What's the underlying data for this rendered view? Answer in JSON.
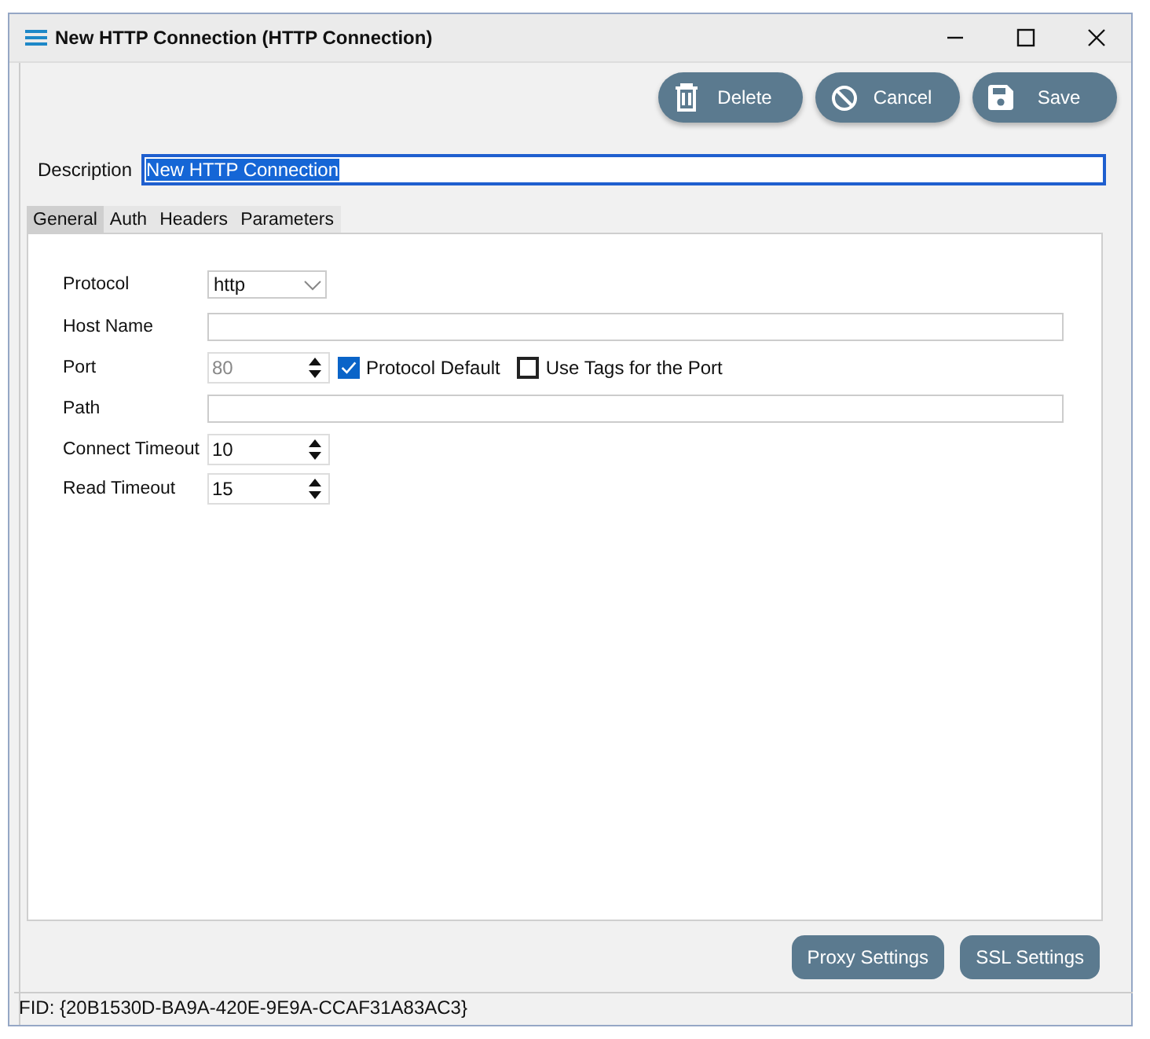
{
  "window": {
    "title": "New HTTP Connection (HTTP Connection)"
  },
  "toolbar": [
    {
      "kind": "delete",
      "label": "Delete"
    },
    {
      "kind": "cancel",
      "label": "Cancel"
    },
    {
      "kind": "save",
      "label": "Save"
    }
  ],
  "description": {
    "label": "Description",
    "value": "New HTTP Connection"
  },
  "tabs": [
    {
      "label": "General",
      "selected": true
    },
    {
      "label": "Auth",
      "selected": false
    },
    {
      "label": "Headers",
      "selected": false
    },
    {
      "label": "Parameters",
      "selected": false
    }
  ],
  "fields": [
    {
      "kind": "combo",
      "label": "Protocol",
      "value": "http"
    },
    {
      "kind": "text",
      "label": "Host Name"
    },
    {
      "kind": "spin",
      "label": "Port",
      "value": "80",
      "disabled": true,
      "checkboxes": [
        {
          "label": "Protocol Default",
          "checked": true
        },
        {
          "label": "Use Tags for the Port",
          "checked": false
        }
      ]
    },
    {
      "kind": "text",
      "label": "Path"
    },
    {
      "kind": "spin",
      "label": "Connect Timeout",
      "value": "10",
      "disabled": false
    },
    {
      "kind": "spin",
      "label": "Read Timeout",
      "value": "15",
      "disabled": false
    }
  ],
  "bottom_buttons": [
    "Proxy Settings",
    "SSL Settings"
  ],
  "status_bar": "FID: {20B1530D-BA9A-420E-9E9A-CCAF31A83AC3}"
}
